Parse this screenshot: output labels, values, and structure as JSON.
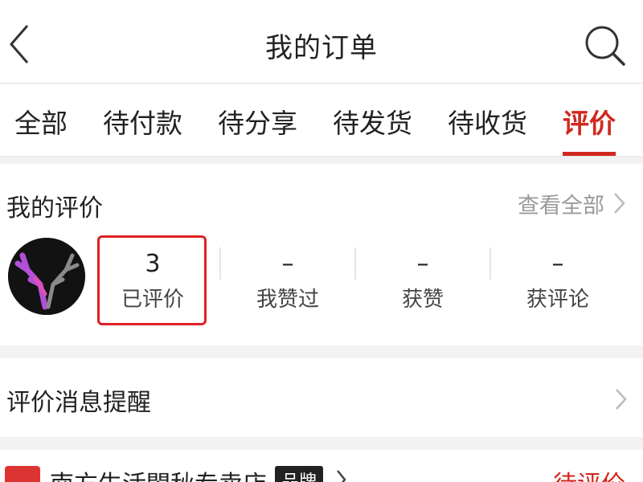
{
  "header": {
    "title": "我的订单",
    "back_icon": "chevron-left-icon",
    "search_icon": "search-icon"
  },
  "tabs": [
    {
      "label": "全部"
    },
    {
      "label": "待付款"
    },
    {
      "label": "待分享"
    },
    {
      "label": "待发货"
    },
    {
      "label": "待收货"
    },
    {
      "label": "评价"
    }
  ],
  "active_tab": "评价",
  "my_reviews": {
    "title": "我的评价",
    "view_all": "查看全部",
    "stats": [
      {
        "value": "3",
        "label": "已评价"
      },
      {
        "value": "–",
        "label": "我赞过"
      },
      {
        "value": "–",
        "label": "获赞"
      },
      {
        "value": "–",
        "label": "获评论"
      }
    ]
  },
  "reminder": {
    "label": "评价消息提醒"
  },
  "shop": {
    "name": "南方生活閤秋专卖店",
    "badge": "品牌",
    "status": "待评价"
  },
  "colors": {
    "accent": "#d0281e",
    "highlight_box": "#e02020"
  }
}
